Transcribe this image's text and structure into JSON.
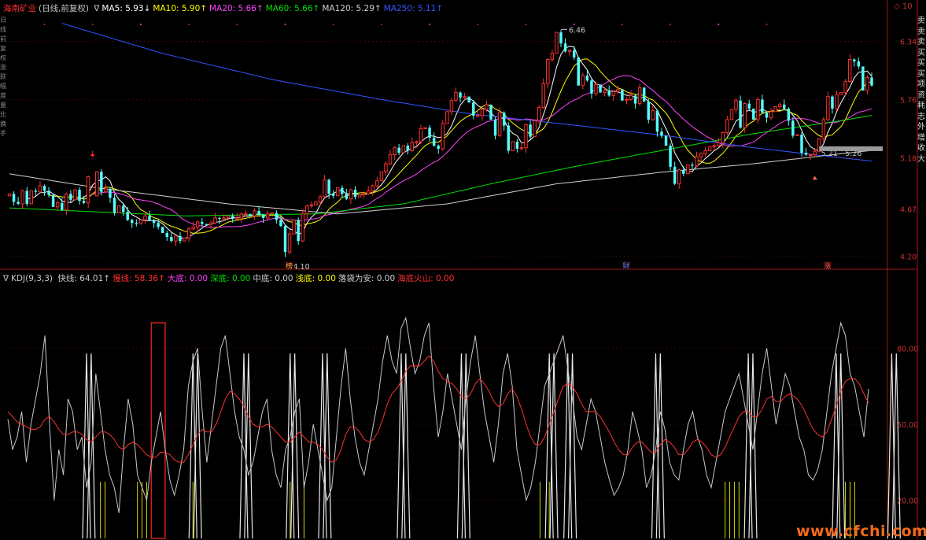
{
  "header": {
    "stock_name": "海南矿业",
    "mode": "(日线,前复权)",
    "ma_prefix": "∇",
    "mas": [
      {
        "label": "MA5: 5.93↓",
        "color": "#ffffff"
      },
      {
        "label": "MA10: 5.90↑",
        "color": "#ffff00"
      },
      {
        "label": "MA20: 5.66↑",
        "color": "#ff44ff"
      },
      {
        "label": "MA60: 5.66↑",
        "color": "#00e000"
      },
      {
        "label": "MA120: 5.29↑",
        "color": "#d0d0d0"
      },
      {
        "label": "MA250: 5.11↑",
        "color": "#3355ff"
      }
    ],
    "top_right": "◇ 10"
  },
  "indicator_header": {
    "prefix": "∇",
    "name": "KDJ(9,3,3)",
    "items": [
      {
        "label": "快线: 64.01↑",
        "color": "#c8c8c8"
      },
      {
        "label": "慢线: 58.36↑",
        "color": "#ff3030"
      },
      {
        "label": "大底: 0.00",
        "color": "#ff44ff"
      },
      {
        "label": "深底: 0.00",
        "color": "#00e000"
      },
      {
        "label": "中底: 0.00",
        "color": "#d0d0d0"
      },
      {
        "label": "浅底: 0.00",
        "color": "#ffff00"
      },
      {
        "label": "落袋为安: 0.00",
        "color": "#d0d0d0"
      },
      {
        "label": "海底火山: 0.00",
        "color": "#ff3030"
      }
    ]
  },
  "sidebar_text": "卖卖卖买买买项资耗志外增收大",
  "leftbar_text": "日线前复权涨跌幅度量比换手",
  "watermark": "www.cfchi.com",
  "annotations": {
    "high": "6.46",
    "low": "4.10",
    "recent_range": "5.21 - 5.26",
    "markers": [
      {
        "text": "榜",
        "color": "#ffaa44",
        "i": 64
      },
      {
        "text": "财",
        "color": "#4488ff",
        "i": 141
      },
      {
        "text": "涨",
        "color": "#ff6060",
        "i": 187
      }
    ]
  },
  "chart_data": [
    {
      "type": "candlestick",
      "title": "海南矿业 (日线,前复权)",
      "yticks": [
        "6.34",
        "5.76",
        "5.18",
        "4.67",
        "4.20"
      ],
      "ylim": [
        4.1,
        6.58
      ],
      "grid": true,
      "up_color": "#ff3030",
      "down_color": "#54ffff",
      "closes": [
        4.82,
        4.74,
        4.72,
        4.85,
        4.72,
        4.85,
        4.84,
        4.9,
        4.85,
        4.81,
        4.69,
        4.73,
        4.66,
        4.82,
        4.76,
        4.86,
        4.75,
        4.73,
        4.99,
        5.21,
        5.04,
        4.84,
        4.87,
        4.78,
        4.63,
        4.7,
        4.64,
        4.56,
        4.53,
        4.52,
        4.56,
        4.6,
        4.56,
        4.53,
        4.49,
        4.43,
        4.39,
        4.35,
        4.4,
        4.35,
        4.38,
        4.47,
        4.49,
        4.54,
        4.52,
        4.51,
        4.53,
        4.58,
        4.57,
        4.58,
        4.6,
        4.57,
        4.58,
        4.62,
        4.62,
        4.6,
        4.65,
        4.61,
        4.58,
        4.62,
        4.63,
        4.56,
        4.5,
        4.24,
        4.42,
        4.56,
        4.35,
        4.62,
        4.7,
        4.71,
        4.74,
        4.79,
        4.96,
        4.82,
        4.8,
        4.88,
        4.82,
        4.77,
        4.86,
        4.79,
        4.81,
        4.82,
        4.85,
        4.9,
        4.95,
        5.04,
        5.12,
        5.21,
        5.28,
        5.23,
        5.3,
        5.25,
        5.33,
        5.34,
        5.47,
        5.48,
        5.38,
        5.3,
        5.27,
        5.52,
        5.64,
        5.75,
        5.83,
        5.78,
        5.79,
        5.73,
        5.6,
        5.6,
        5.66,
        5.71,
        5.56,
        5.4,
        5.63,
        5.5,
        5.25,
        5.34,
        5.27,
        5.28,
        5.51,
        5.39,
        5.55,
        5.68,
        5.92,
        6.16,
        6.22,
        6.43,
        6.32,
        6.24,
        6.25,
        6.18,
        5.9,
        6.0,
        5.95,
        5.82,
        5.91,
        5.83,
        5.85,
        5.8,
        5.84,
        5.86,
        5.75,
        5.76,
        5.8,
        5.72,
        5.88,
        5.74,
        5.56,
        5.65,
        5.44,
        5.4,
        5.3,
        5.09,
        4.92,
        5.06,
        5.02,
        5.11,
        5.1,
        5.19,
        5.22,
        5.25,
        5.29,
        5.3,
        5.33,
        5.43,
        5.56,
        5.66,
        5.75,
        5.48,
        5.72,
        5.67,
        5.56,
        5.76,
        5.63,
        5.58,
        5.64,
        5.69,
        5.71,
        5.67,
        5.55,
        5.4,
        5.41,
        5.23,
        5.21,
        5.21,
        5.24,
        5.37,
        5.56,
        5.79,
        5.67,
        5.81,
        5.83,
        5.94,
        6.16,
        6.14,
        6.09,
        5.85,
        5.98,
        5.9
      ],
      "opens": [
        4.8,
        4.82,
        4.74,
        4.72,
        4.85,
        4.72,
        4.85,
        4.84,
        4.9,
        4.85,
        4.81,
        4.69,
        4.73,
        4.66,
        4.82,
        4.76,
        4.86,
        4.75,
        4.73,
        5.21,
        4.8,
        5.04,
        4.84,
        4.87,
        4.78,
        4.63,
        4.7,
        4.64,
        4.56,
        4.53,
        4.52,
        4.56,
        4.6,
        4.56,
        4.53,
        4.49,
        4.43,
        4.39,
        4.35,
        4.4,
        4.35,
        4.38,
        4.47,
        4.49,
        4.54,
        4.52,
        4.51,
        4.53,
        4.58,
        4.57,
        4.58,
        4.6,
        4.57,
        4.58,
        4.62,
        4.62,
        4.6,
        4.65,
        4.61,
        4.58,
        4.62,
        4.63,
        4.56,
        4.5,
        4.24,
        4.42,
        4.56,
        4.35,
        4.62,
        4.7,
        4.71,
        4.74,
        4.79,
        4.96,
        4.82,
        4.8,
        4.88,
        4.82,
        4.77,
        4.86,
        4.79,
        4.81,
        4.82,
        4.85,
        4.9,
        4.95,
        5.04,
        5.12,
        5.21,
        5.28,
        5.23,
        5.3,
        5.25,
        5.33,
        5.34,
        5.47,
        5.48,
        5.38,
        5.3,
        5.27,
        5.52,
        5.64,
        5.75,
        5.83,
        5.78,
        5.79,
        5.73,
        5.6,
        5.6,
        5.66,
        5.71,
        5.56,
        5.4,
        5.63,
        5.5,
        5.25,
        5.34,
        5.27,
        5.28,
        5.51,
        5.39,
        5.55,
        5.68,
        5.92,
        6.16,
        6.22,
        6.43,
        6.32,
        6.24,
        6.25,
        6.18,
        5.9,
        6.0,
        5.95,
        5.82,
        5.91,
        5.83,
        5.85,
        5.8,
        5.84,
        5.86,
        5.75,
        5.76,
        5.8,
        5.72,
        5.88,
        5.74,
        5.56,
        5.65,
        5.44,
        5.4,
        5.3,
        5.09,
        4.92,
        5.06,
        5.02,
        5.11,
        5.1,
        5.19,
        5.22,
        5.25,
        5.29,
        5.3,
        5.33,
        5.43,
        5.56,
        5.66,
        5.75,
        5.48,
        5.72,
        5.67,
        5.56,
        5.76,
        5.63,
        5.58,
        5.64,
        5.69,
        5.71,
        5.67,
        5.55,
        5.4,
        5.41,
        5.23,
        5.21,
        5.21,
        5.24,
        5.37,
        5.56,
        5.79,
        5.67,
        5.81,
        5.83,
        5.94,
        6.16,
        6.14,
        6.09,
        5.85,
        5.98
      ],
      "highs_pad": 0.05,
      "ma_series": [
        {
          "name": "MA5",
          "color": "#ffffff",
          "period": 5
        },
        {
          "name": "MA10",
          "color": "#ffff00",
          "period": 10
        },
        {
          "name": "MA20",
          "color": "#ff44ff",
          "period": 20
        },
        {
          "name": "MA60",
          "color": "#00e000",
          "from": [
            4.68,
            4.6,
            4.62,
            4.72,
            4.92,
            5.1,
            5.26,
            5.42,
            5.55,
            5.66
          ],
          "points_at": [
            0,
            40,
            70,
            90,
            110,
            130,
            150,
            170,
            190,
            205
          ]
        },
        {
          "name": "MA120",
          "color": "#d0d0d0",
          "from": [
            5.02,
            4.88,
            4.72,
            4.62,
            4.72,
            4.92,
            5.04,
            5.12,
            5.22,
            5.29
          ],
          "points_at": [
            0,
            20,
            50,
            75,
            100,
            125,
            150,
            170,
            190,
            205
          ]
        },
        {
          "name": "MA250",
          "color": "#3355ff",
          "from": [
            6.52,
            6.22,
            5.96,
            5.76,
            5.62,
            5.5,
            5.4,
            5.28,
            5.18,
            5.11
          ],
          "points_at": [
            12,
            35,
            60,
            85,
            105,
            130,
            150,
            170,
            190,
            205
          ]
        }
      ]
    },
    {
      "type": "line",
      "title": "KDJ(9,3,3)",
      "yticks": [
        "80.00",
        "50.00",
        "20.00"
      ],
      "ylim": [
        0,
        100
      ],
      "series": [
        {
          "name": "快线",
          "color": "#c8c8c8",
          "values": [
            52,
            40,
            45,
            55,
            35,
            50,
            60,
            70,
            85,
            50,
            20,
            40,
            30,
            60,
            55,
            40,
            45,
            25,
            35,
            70,
            55,
            40,
            30,
            25,
            15,
            40,
            60,
            50,
            30,
            25,
            20,
            35,
            45,
            55,
            40,
            28,
            22,
            30,
            40,
            65,
            75,
            80,
            55,
            35,
            50,
            65,
            80,
            85,
            70,
            55,
            45,
            40,
            30,
            35,
            45,
            55,
            60,
            40,
            30,
            25,
            40,
            45,
            55,
            60,
            25,
            35,
            50,
            40,
            30,
            20,
            25,
            45,
            65,
            80,
            60,
            45,
            35,
            30,
            40,
            50,
            60,
            75,
            85,
            75,
            70,
            88,
            92,
            80,
            70,
            75,
            85,
            90,
            65,
            45,
            55,
            70,
            60,
            50,
            40,
            60,
            75,
            85,
            70,
            55,
            45,
            35,
            50,
            70,
            78,
            65,
            40,
            30,
            20,
            25,
            35,
            50,
            65,
            70,
            75,
            80,
            85,
            72,
            60,
            45,
            40,
            50,
            60,
            55,
            45,
            35,
            28,
            22,
            25,
            30,
            40,
            55,
            48,
            40,
            25,
            30,
            40,
            55,
            48,
            35,
            30,
            28,
            40,
            50,
            55,
            45,
            40,
            30,
            25,
            35,
            45,
            55,
            60,
            65,
            70,
            60,
            50,
            40,
            55,
            70,
            80,
            65,
            50,
            60,
            70,
            65,
            55,
            45,
            40,
            30,
            28,
            32,
            40,
            55,
            70,
            80,
            90,
            85,
            70,
            65,
            55,
            45,
            64
          ]
        },
        {
          "name": "慢线",
          "color": "#ff3030",
          "values": [
            55,
            53,
            51,
            50,
            49,
            48,
            48,
            49,
            52,
            53,
            51,
            48,
            46,
            46,
            47,
            47,
            46,
            44,
            43,
            45,
            47,
            47,
            46,
            44,
            41,
            40,
            42,
            43,
            42,
            40,
            38,
            37,
            37,
            39,
            39,
            38,
            36,
            35,
            35,
            38,
            42,
            46,
            48,
            47,
            47,
            50,
            55,
            60,
            63,
            62,
            60,
            57,
            53,
            50,
            49,
            49,
            50,
            49,
            47,
            45,
            43,
            43,
            45,
            47,
            45,
            43,
            43,
            42,
            40,
            37,
            35,
            36,
            40,
            46,
            49,
            49,
            47,
            44,
            43,
            44,
            47,
            52,
            58,
            62,
            64,
            67,
            71,
            73,
            73,
            73,
            75,
            77,
            75,
            71,
            68,
            67,
            66,
            64,
            61,
            60,
            62,
            66,
            68,
            66,
            63,
            59,
            57,
            58,
            62,
            64,
            61,
            56,
            50,
            45,
            42,
            42,
            45,
            50,
            55,
            60,
            65,
            66,
            65,
            62,
            58,
            55,
            55,
            55,
            53,
            50,
            47,
            43,
            40,
            38,
            38,
            41,
            43,
            43,
            41,
            39,
            39,
            42,
            44,
            43,
            41,
            38,
            38,
            40,
            43,
            44,
            43,
            41,
            38,
            37,
            38,
            41,
            45,
            49,
            53,
            55,
            55,
            53,
            53,
            56,
            60,
            61,
            59,
            59,
            61,
            62,
            61,
            59,
            56,
            52,
            48,
            46,
            45,
            47,
            52,
            57,
            63,
            67,
            68,
            68,
            66,
            62,
            58.36
          ]
        }
      ],
      "spikes_white": [
        17,
        18,
        40,
        41,
        51,
        52,
        61,
        62,
        68,
        69,
        85,
        86,
        98,
        99,
        117,
        118,
        121,
        122,
        140,
        141,
        160,
        161,
        179,
        180,
        191,
        192
      ],
      "spikes_yellow": [
        20,
        21,
        28,
        29,
        30,
        40,
        61,
        64,
        115,
        117,
        155,
        156,
        157,
        158,
        181,
        182,
        183
      ],
      "red_block": [
        31,
        34
      ]
    }
  ]
}
